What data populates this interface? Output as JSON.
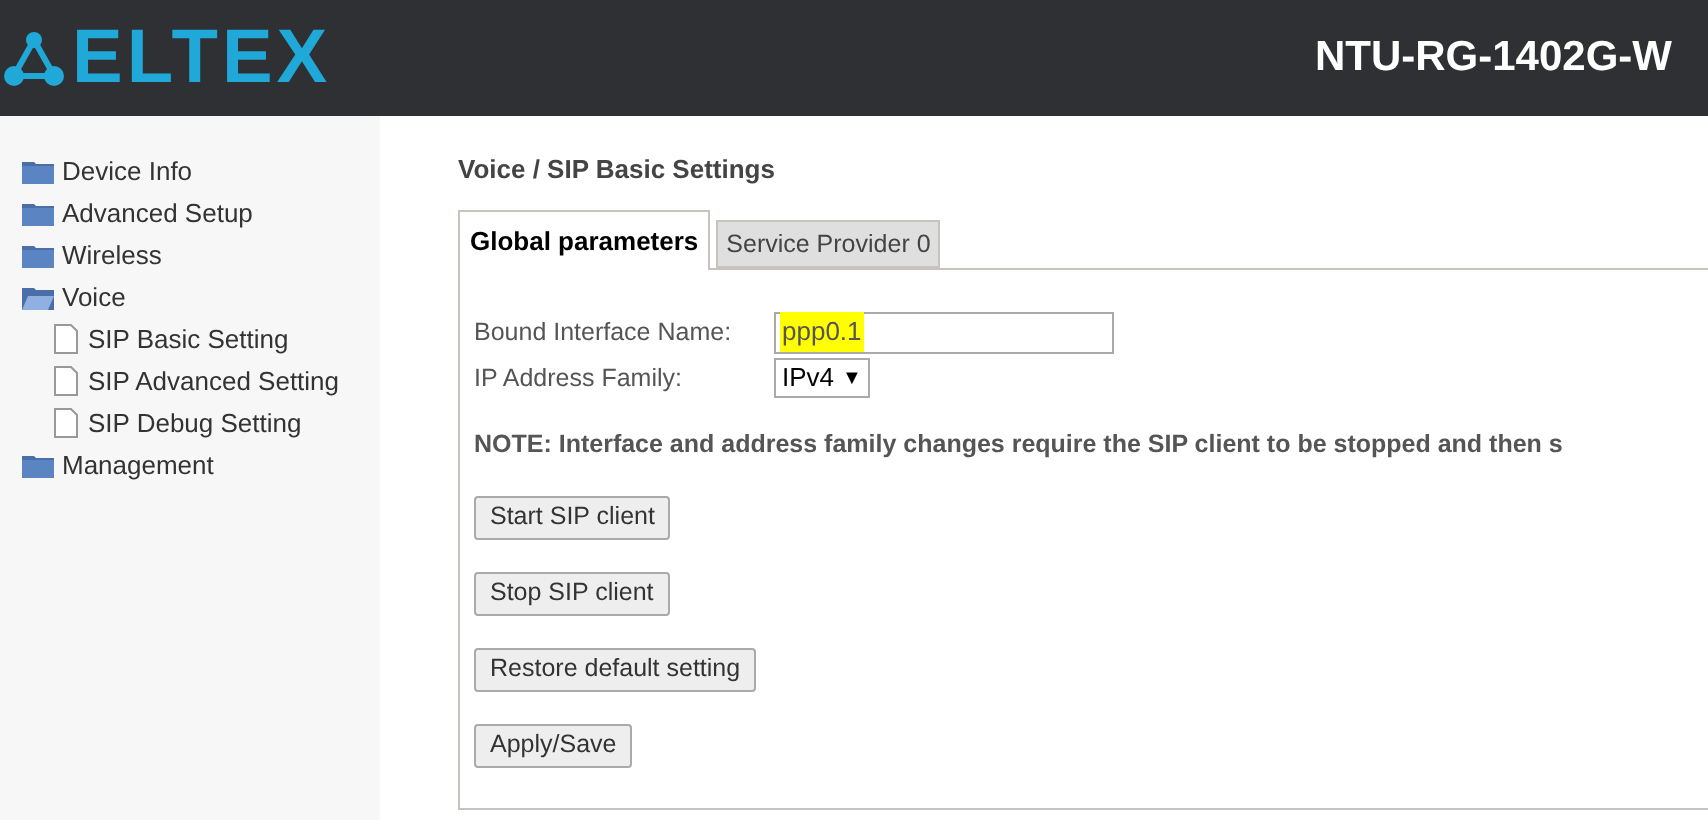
{
  "header": {
    "logo": "ELTEX",
    "model": "NTU-RG-1402G-W"
  },
  "sidebar": {
    "items": [
      {
        "label": "Device Info",
        "expanded": false
      },
      {
        "label": "Advanced Setup",
        "expanded": false
      },
      {
        "label": "Wireless",
        "expanded": false
      },
      {
        "label": "Voice",
        "expanded": true,
        "children": [
          {
            "label": "SIP Basic Setting"
          },
          {
            "label": "SIP Advanced Setting"
          },
          {
            "label": "SIP Debug Setting"
          }
        ]
      },
      {
        "label": "Management",
        "expanded": false
      }
    ]
  },
  "page_title": "Voice / SIP Basic Settings",
  "tabs": [
    {
      "label": "Global parameters",
      "selected": true
    },
    {
      "label": "Service Provider 0",
      "selected": false
    }
  ],
  "fields": [
    {
      "kind": "text",
      "label": "Bound Interface Name:",
      "value": "ppp0.1",
      "highlighted": true
    },
    {
      "kind": "select",
      "label": "IP Address Family:",
      "value": "IPv4",
      "arrow": "▼"
    }
  ],
  "note": "NOTE: Interface and address family changes require the SIP client to be stopped and then s",
  "buttons": [
    "Start SIP client",
    "Stop SIP client",
    "Restore default setting",
    "Apply/Save"
  ]
}
